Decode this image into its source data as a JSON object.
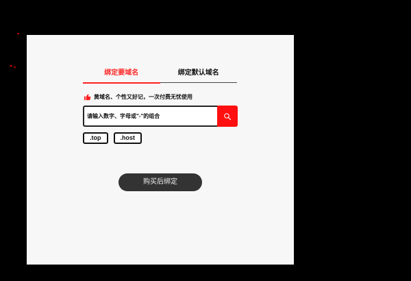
{
  "tabs": [
    {
      "label": "绑定要域名",
      "active": true
    },
    {
      "label": "绑定默认域名",
      "active": false
    }
  ],
  "promo": {
    "text": "黄域名、个性又好记，一次付费无忧使用",
    "icon": "thumbs-up-icon"
  },
  "search": {
    "placeholder": "请输入数字、字母或\"-\"的组合",
    "button_icon": "search-icon"
  },
  "tlds": [
    ".top",
    ".host"
  ],
  "actions": {
    "buy_bind_label": "购买后绑定"
  },
  "colors": {
    "accent": "#ff1e1e",
    "panel_bg": "#f7f7f7",
    "button_dark": "#333333",
    "page_bg": "#000000"
  }
}
